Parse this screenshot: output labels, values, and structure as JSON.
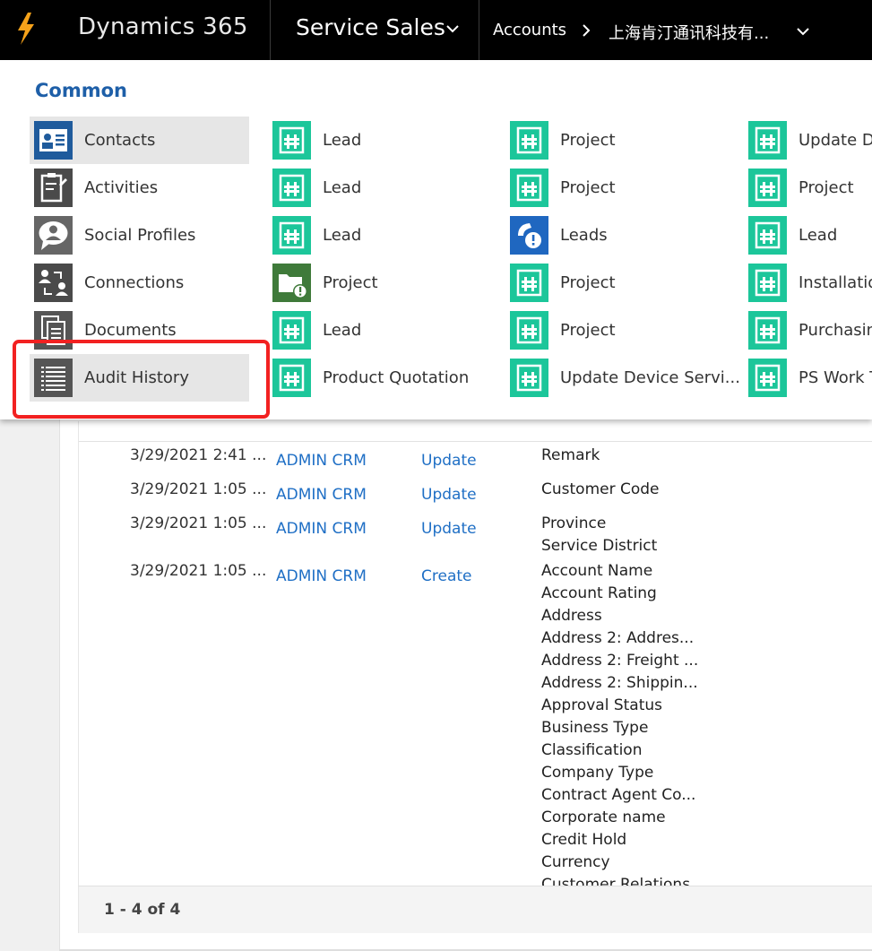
{
  "topbar": {
    "brand": "Dynamics 365",
    "app_name": "Service Sales",
    "breadcrumb_entity": "Accounts",
    "breadcrumb_record": "上海肯汀通讯科技有..."
  },
  "menu": {
    "section_title": "Common",
    "columns": [
      {
        "items": [
          {
            "label": "Contacts",
            "icon": "contacts-icon",
            "state": "selected"
          },
          {
            "label": "Activities",
            "icon": "activities-icon"
          },
          {
            "label": "Social Profiles",
            "icon": "social-profiles-icon"
          },
          {
            "label": "Connections",
            "icon": "connections-icon"
          },
          {
            "label": "Documents",
            "icon": "documents-icon"
          },
          {
            "label": "Audit History",
            "icon": "audit-history-icon",
            "state": "hover"
          }
        ]
      },
      {
        "items": [
          {
            "label": "Lead",
            "icon": "custom-entity-icon"
          },
          {
            "label": "Lead",
            "icon": "custom-entity-icon"
          },
          {
            "label": "Lead",
            "icon": "custom-entity-icon"
          },
          {
            "label": "Project",
            "icon": "project-alert-icon"
          },
          {
            "label": "Lead",
            "icon": "custom-entity-icon"
          },
          {
            "label": "Product Quotation",
            "icon": "custom-entity-icon"
          }
        ]
      },
      {
        "items": [
          {
            "label": "Project",
            "icon": "custom-entity-icon"
          },
          {
            "label": "Project",
            "icon": "custom-entity-icon"
          },
          {
            "label": "Leads",
            "icon": "leads-phone-alert-icon"
          },
          {
            "label": "Project",
            "icon": "custom-entity-icon"
          },
          {
            "label": "Project",
            "icon": "custom-entity-icon"
          },
          {
            "label": "Update Device Servi...",
            "icon": "custom-entity-icon"
          }
        ]
      },
      {
        "items": [
          {
            "label": "Update De",
            "icon": "custom-entity-icon"
          },
          {
            "label": "Project",
            "icon": "custom-entity-icon"
          },
          {
            "label": "Lead",
            "icon": "custom-entity-icon"
          },
          {
            "label": "Installation",
            "icon": "custom-entity-icon"
          },
          {
            "label": "Purchasing",
            "icon": "custom-entity-icon"
          },
          {
            "label": "PS Work T",
            "icon": "custom-entity-icon"
          }
        ]
      }
    ]
  },
  "audit_grid": {
    "rows": [
      {
        "changed_date": "3/29/2021 2:41 ...",
        "changed_by": "ADMIN CRM",
        "event": "Update",
        "fields": [
          "Remark"
        ]
      },
      {
        "changed_date": "3/29/2021 1:05 ...",
        "changed_by": "ADMIN CRM",
        "event": "Update",
        "fields": [
          "Customer Code"
        ]
      },
      {
        "changed_date": "3/29/2021 1:05 ...",
        "changed_by": "ADMIN CRM",
        "event": "Update",
        "fields": [
          "Province",
          "Service District"
        ]
      },
      {
        "changed_date": "3/29/2021 1:05 ...",
        "changed_by": "ADMIN CRM",
        "event": "Create",
        "fields": [
          "Account Name",
          "Account Rating",
          "Address",
          "Address 2: Addres...",
          "Address 2: Freight ...",
          "Address 2: Shippin...",
          "Approval Status",
          "Business Type",
          "Classification",
          "Company Type",
          "Contract Agent Co...",
          "Corporate name",
          "Credit Hold",
          "Currency",
          "Customer Relations"
        ]
      }
    ],
    "paging": "1 - 4 of 4"
  },
  "colors": {
    "topbar": "#000000",
    "accent_blue": "#1e5fa8",
    "link_blue": "#1f6fc5",
    "custom_entity_green": "#1cc69a",
    "highlight_red": "#f22121"
  }
}
